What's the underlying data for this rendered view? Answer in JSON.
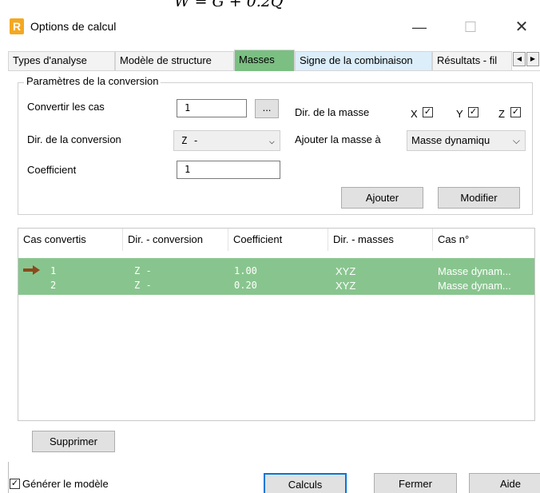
{
  "formula": "W = G + 0.2Q",
  "window": {
    "title": "Options de calcul",
    "app_icon_letter": "R",
    "minimize": "—",
    "maximize": "☐",
    "close": "✕"
  },
  "tabs": [
    {
      "label": "Types d'analyse"
    },
    {
      "label": "Modèle de structure"
    },
    {
      "label": "Masses"
    },
    {
      "label": "Signe de la combinaison"
    },
    {
      "label": "Résultats - fil"
    }
  ],
  "group": {
    "title": "Paramètres de la conversion",
    "convert_label": "Convertir les cas",
    "convert_value": "1",
    "browse_label": "...",
    "mass_dir_label": "Dir. de la masse",
    "x_label": "X",
    "y_label": "Y",
    "z_label": "Z",
    "x_checked": true,
    "y_checked": true,
    "z_checked": true,
    "conv_dir_label": "Dir. de la conversion",
    "conv_dir_value": "Z -",
    "add_mass_label": "Ajouter la masse à",
    "add_mass_value": "Masse dynamiqu",
    "coef_label": "Coefficient",
    "coef_value": "1",
    "add_button": "Ajouter",
    "modify_button": "Modifier"
  },
  "table": {
    "columns": [
      "Cas convertis",
      "Dir. - conversion",
      "Coefficient",
      "Dir. - masses",
      "Cas n°"
    ],
    "rows": [
      {
        "case": "1",
        "dir": "Z -",
        "coef": "1.00",
        "mass_dir": "XYZ",
        "case_no": "Masse dynam..."
      },
      {
        "case": "2",
        "dir": "Z -",
        "coef": "0.20",
        "mass_dir": "XYZ",
        "case_no": "Masse dynam..."
      }
    ]
  },
  "delete_button": "Supprimer",
  "footer": {
    "generate_label": "Générer le modèle",
    "generate_checked": true,
    "calc_button": "Calculs",
    "close_button": "Fermer",
    "help_button": "Aide"
  },
  "colors": {
    "highlight": "#7bbf82",
    "arrow": "#8a4a1c"
  }
}
